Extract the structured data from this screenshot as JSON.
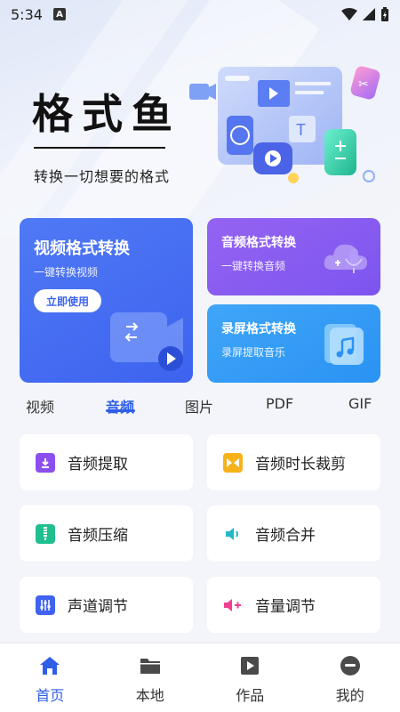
{
  "status_bar": {
    "time": "5:34",
    "indicator": "A"
  },
  "hero": {
    "title": "格式鱼",
    "subtitle": "转换一切想要的格式"
  },
  "cards": {
    "video": {
      "title": "视频格式转换",
      "desc": "一键转换视频",
      "button": "立即使用"
    },
    "audio": {
      "title": "音频格式转换",
      "desc": "一键转换音频"
    },
    "screen": {
      "title": "录屏格式转换",
      "desc": "录屏提取音乐"
    }
  },
  "tabs": [
    "视频",
    "音频",
    "图片",
    "PDF",
    "GIF"
  ],
  "active_tab": "音频",
  "tools": [
    {
      "label": "音频提取",
      "icon": "download-icon",
      "color": "#8b4ff0"
    },
    {
      "label": "音频时长裁剪",
      "icon": "trim-icon",
      "color": "#f7b21a"
    },
    {
      "label": "音频压缩",
      "icon": "compress-icon",
      "color": "#1fbf8f"
    },
    {
      "label": "音频合并",
      "icon": "speaker-icon",
      "color": "#22b8c7"
    },
    {
      "label": "声道调节",
      "icon": "sliders-icon",
      "color": "#3f63ef"
    },
    {
      "label": "音量调节",
      "icon": "volume-up-icon",
      "color": "#ef3f8f"
    }
  ],
  "nav": [
    {
      "label": "首页",
      "icon": "home-icon"
    },
    {
      "label": "本地",
      "icon": "folder-icon"
    },
    {
      "label": "作品",
      "icon": "play-icon"
    },
    {
      "label": "我的",
      "icon": "profile-icon"
    }
  ],
  "accent": "#2f5ee8"
}
